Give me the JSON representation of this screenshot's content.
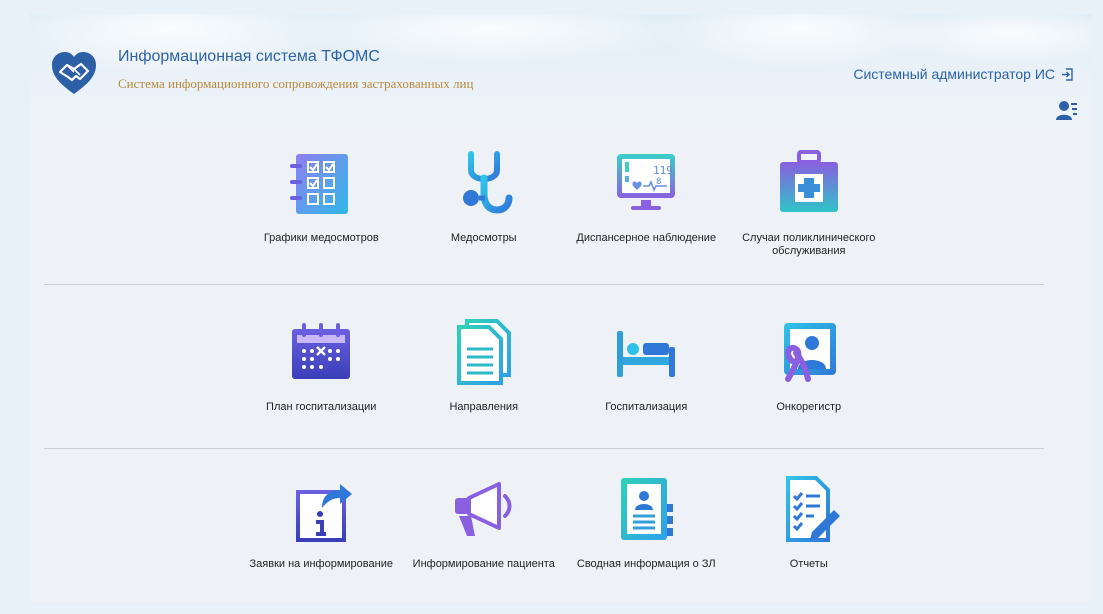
{
  "header": {
    "title": "Информационная система ТФОМС",
    "subtitle": "Система информационного сопровождения застрахованных лиц",
    "user_label": "Системный администратор ИС",
    "logout_icon": "logout-icon",
    "users_icon": "users-list-icon"
  },
  "colors": {
    "title": "#2e63a8",
    "subtitle": "#b8893d",
    "icon_gradient_start": "#2fb8e8",
    "icon_gradient_end": "#7b5fe0"
  },
  "rows": [
    {
      "items": [
        {
          "label": "Графики медосмотров",
          "icon": "schedule-checklist-icon"
        },
        {
          "label": "Медосмотры",
          "icon": "stethoscope-icon"
        },
        {
          "label": "Диспансерное наблюдение",
          "icon": "heart-monitor-icon"
        },
        {
          "label": "Случаи поликлинического обслуживания",
          "icon": "first-aid-kit-icon"
        }
      ]
    },
    {
      "items": [
        {
          "label": "План госпитализации",
          "icon": "calendar-icon"
        },
        {
          "label": "Направления",
          "icon": "document-icon"
        },
        {
          "label": "Госпитализация",
          "icon": "hospital-bed-icon"
        },
        {
          "label": "Онкорегистр",
          "icon": "oncology-ribbon-icon"
        }
      ]
    },
    {
      "items": [
        {
          "label": "Заявки на информирование",
          "icon": "info-share-icon"
        },
        {
          "label": "Информирование пациента",
          "icon": "megaphone-icon"
        },
        {
          "label": "Сводная информация о ЗЛ",
          "icon": "patient-card-icon"
        },
        {
          "label": "Отчеты",
          "icon": "report-icon"
        }
      ]
    }
  ]
}
